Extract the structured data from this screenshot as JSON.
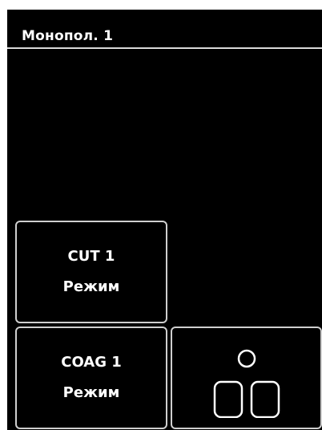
{
  "header": {
    "title": "Монопол. 1"
  },
  "modes": [
    {
      "name_label": "CUT 1",
      "mode_label": "Режим"
    },
    {
      "name_label": "COAG 1",
      "mode_label": "Режим"
    }
  ],
  "footswitch_tile": {
    "icon": "footswitch-icon"
  },
  "colors": {
    "background": "#000000",
    "border": "#cfcfcf",
    "text": "#ffffff",
    "header_rule": "#d9d9d9"
  }
}
